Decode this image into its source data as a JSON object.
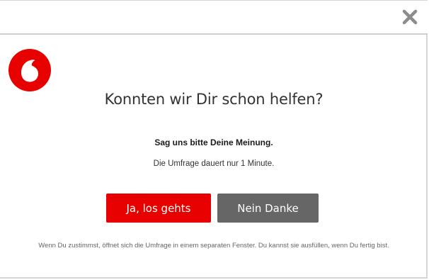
{
  "dialog": {
    "close_icon": "close-icon",
    "logo_icon": "vodafone-logo",
    "headline": "Konnten wir Dir schon helfen?",
    "subheadline": "Sag uns bitte Deine Meinung.",
    "info": "Die Umfrage dauert nur 1 Minute.",
    "accept_label": "Ja, los gehts",
    "decline_label": "Nein Danke",
    "disclaimer": "Wenn Du zustimmst, öffnet sich die Umfrage in einem separaten Fenster. Du kannst sie ausfüllen, wenn Du fertig bist."
  },
  "colors": {
    "brand_red": "#e60000",
    "decline_gray": "#666666",
    "close_gray": "#8c8c8c"
  }
}
